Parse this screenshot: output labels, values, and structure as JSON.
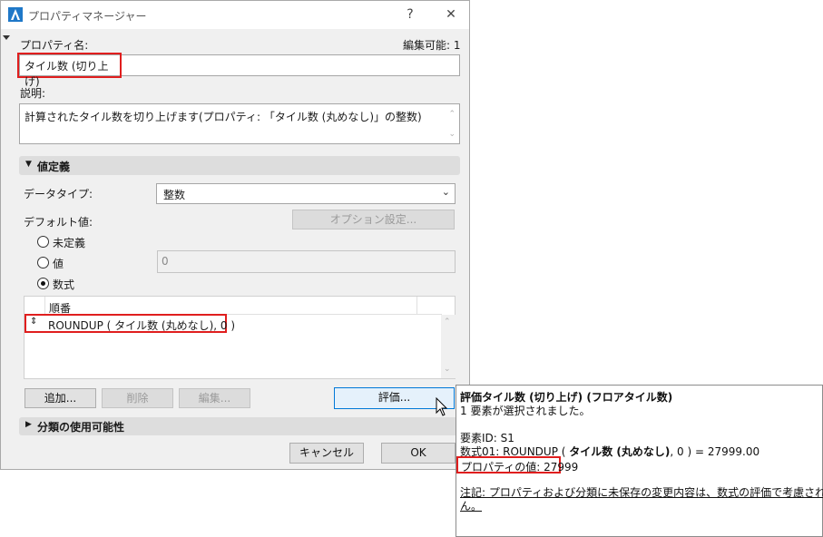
{
  "window": {
    "title": "プロパティマネージャー",
    "help_icon": "?",
    "close_icon": "✕"
  },
  "property_name": {
    "label": "プロパティ名:",
    "edit_status": "編集可能: 1",
    "value": "タイル数 (切り上げ)"
  },
  "description": {
    "label": "説明:",
    "value": "計算されたタイル数を切り上げます(プロパティ: 「タイル数 (丸めなし)」の整数)"
  },
  "value_definition": {
    "header": "値定義",
    "data_type_label": "データタイプ:",
    "data_type_value": "整数",
    "default_value_label": "デフォルト値:",
    "options_button": "オプション設定...",
    "radios": [
      {
        "label": "未定義",
        "selected": false
      },
      {
        "label": "値",
        "selected": false
      },
      {
        "label": "数式",
        "selected": true
      }
    ],
    "value_field": "0",
    "table_header": "順番",
    "formula": "ROUNDUP ( タイル数 (丸めなし), 0 )",
    "add_button": "追加...",
    "delete_button": "削除",
    "edit_button": "編集...",
    "evaluate_button": "評価..."
  },
  "classification": {
    "header": "分類の使用可能性"
  },
  "footer": {
    "cancel_button": "キャンセル",
    "ok_button": "OK"
  },
  "tooltip": {
    "title": "評価タイル数 (切り上げ) (フロアタイル数)",
    "selected": "1 要素が選択されました。",
    "element_id": "要素ID: S1",
    "formula_prefix": "数式01: ROUNDUP ( ",
    "formula_bold": "タイル数 (丸めなし)",
    "formula_suffix": ", 0 ) = 27999.00",
    "property_value": "プロパティの値: 27999",
    "note_line1": "注記: プロパティおよび分類に未保存の変更内容は、数式の評価で考慮されませ",
    "note_line2": "ん。"
  },
  "colors": {
    "highlight": "#e01e1e",
    "logo": "#1f78c8"
  }
}
